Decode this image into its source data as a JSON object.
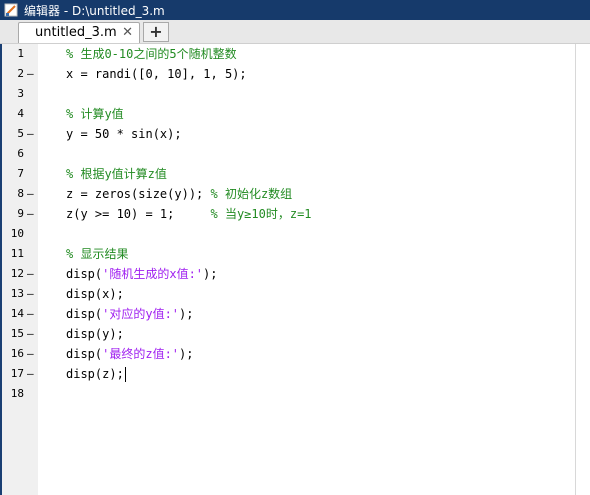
{
  "window": {
    "title": "编辑器 - D:\\untitled_3.m",
    "icon": "editor-app-icon"
  },
  "tabs": [
    {
      "label": "untitled_3.m",
      "close_label": "✕"
    }
  ],
  "add_tab_label": "+",
  "lines": [
    {
      "n": "1",
      "marker": "",
      "parts": [
        {
          "t": "% 生成0-10之间的5个随机整数",
          "k": "comment"
        }
      ]
    },
    {
      "n": "2",
      "marker": "–",
      "parts": [
        {
          "t": "x = randi([0, 10], 1, 5);",
          "k": "code"
        }
      ]
    },
    {
      "n": "3",
      "marker": "",
      "parts": []
    },
    {
      "n": "4",
      "marker": "",
      "parts": [
        {
          "t": "% 计算y值",
          "k": "comment"
        }
      ]
    },
    {
      "n": "5",
      "marker": "–",
      "parts": [
        {
          "t": "y = 50 * sin(x);",
          "k": "code"
        }
      ]
    },
    {
      "n": "6",
      "marker": "",
      "parts": []
    },
    {
      "n": "7",
      "marker": "",
      "parts": [
        {
          "t": "% 根据y值计算z值",
          "k": "comment"
        }
      ]
    },
    {
      "n": "8",
      "marker": "–",
      "parts": [
        {
          "t": "z = zeros(size(y)); ",
          "k": "code"
        },
        {
          "t": "% 初始化z数组",
          "k": "comment"
        }
      ]
    },
    {
      "n": "9",
      "marker": "–",
      "parts": [
        {
          "t": "z(y >= 10) = 1;     ",
          "k": "code"
        },
        {
          "t": "% 当y≥10时，z=1",
          "k": "comment"
        }
      ]
    },
    {
      "n": "10",
      "marker": "",
      "parts": []
    },
    {
      "n": "11",
      "marker": "",
      "parts": [
        {
          "t": "% 显示结果",
          "k": "comment"
        }
      ]
    },
    {
      "n": "12",
      "marker": "–",
      "parts": [
        {
          "t": "disp(",
          "k": "code"
        },
        {
          "t": "'随机生成的x值:'",
          "k": "string"
        },
        {
          "t": ");",
          "k": "code"
        }
      ]
    },
    {
      "n": "13",
      "marker": "–",
      "parts": [
        {
          "t": "disp(x);",
          "k": "code"
        }
      ]
    },
    {
      "n": "14",
      "marker": "–",
      "parts": [
        {
          "t": "disp(",
          "k": "code"
        },
        {
          "t": "'对应的y值:'",
          "k": "string"
        },
        {
          "t": ");",
          "k": "code"
        }
      ]
    },
    {
      "n": "15",
      "marker": "–",
      "parts": [
        {
          "t": "disp(y);",
          "k": "code"
        }
      ]
    },
    {
      "n": "16",
      "marker": "–",
      "parts": [
        {
          "t": "disp(",
          "k": "code"
        },
        {
          "t": "'最终的z值:'",
          "k": "string"
        },
        {
          "t": ");",
          "k": "code"
        }
      ]
    },
    {
      "n": "17",
      "marker": "–",
      "parts": [
        {
          "t": "disp(z);",
          "k": "code"
        }
      ],
      "cursor": true
    },
    {
      "n": "18",
      "marker": "",
      "parts": []
    }
  ],
  "colors": {
    "titlebar": "#163a6b",
    "comment": "#228b22",
    "string": "#a020f0",
    "gutter": "#f0f0f0"
  }
}
